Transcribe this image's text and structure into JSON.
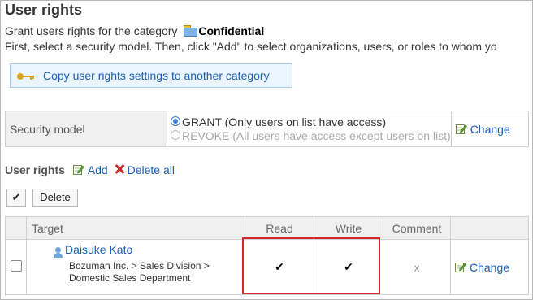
{
  "page": {
    "title": "User rights",
    "intro_prefix": "Grant users rights for the category",
    "category_name": "Confidential",
    "instruction": "First, select a security model. Then, click \"Add\" to select organizations, users, or roles to whom yo"
  },
  "copy_button": {
    "label": "Copy user rights settings to another category",
    "icon": "key-icon"
  },
  "security_model": {
    "label": "Security model",
    "options": [
      {
        "label": "GRANT (Only users on list have access)",
        "selected": true,
        "enabled": true
      },
      {
        "label": "REVOKE (All users have access except users on list)",
        "selected": false,
        "enabled": false
      }
    ],
    "change_label": "Change"
  },
  "user_rights": {
    "label": "User rights",
    "add_label": "Add",
    "delete_all_label": "Delete all",
    "toggle_symbol": "✔",
    "delete_label": "Delete"
  },
  "rights_table": {
    "headers": {
      "target": "Target",
      "read": "Read",
      "write": "Write",
      "comment": "Comment"
    },
    "rows": [
      {
        "name": "Daisuke Kato",
        "department": "Bozuman Inc. > Sales Division > Domestic Sales Department",
        "read": "✔",
        "write": "✔",
        "comment": "x",
        "change_label": "Change"
      }
    ]
  },
  "colors": {
    "link": "#1a5fb4",
    "highlight": "#d62828",
    "header_bg": "#f0f0f0",
    "copy_button_bg": "#ebf5ff"
  }
}
